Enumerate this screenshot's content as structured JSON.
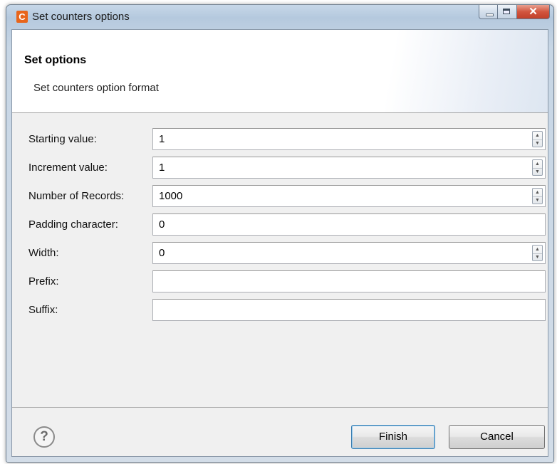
{
  "window": {
    "title": "Set counters options",
    "app_icon_letter": "C",
    "controls": {
      "minimize": "—",
      "maximize": "▢",
      "close": "✕"
    }
  },
  "banner": {
    "title": "Set options",
    "description": "Set counters option format"
  },
  "form": {
    "starting_value": {
      "label": "Starting value:",
      "value": "1",
      "spinner": true
    },
    "increment_value": {
      "label": "Increment value:",
      "value": "1",
      "spinner": true
    },
    "number_of_records": {
      "label": "Number of Records:",
      "value": "1000",
      "spinner": true
    },
    "padding_character": {
      "label": "Padding character:",
      "value": "0",
      "spinner": false
    },
    "width": {
      "label": "Width:",
      "value": "0",
      "spinner": true
    },
    "prefix": {
      "label": "Prefix:",
      "value": "",
      "spinner": false
    },
    "suffix": {
      "label": "Suffix:",
      "value": "",
      "spinner": false
    }
  },
  "footer": {
    "help_icon": "?",
    "finish_label": "Finish",
    "cancel_label": "Cancel"
  },
  "colors": {
    "app_icon": "#e8651b",
    "close_button": "#c1402a",
    "default_button_border": "#3c7fb1"
  }
}
